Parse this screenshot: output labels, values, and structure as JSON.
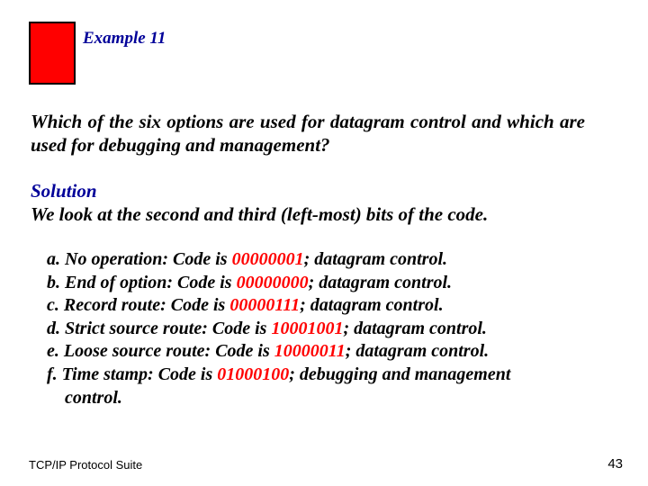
{
  "title": "Example 11",
  "question": "Which of the six options are used for datagram control and which are used for debugging and management?",
  "solution_label": "Solution",
  "solution_text": "We look at the second and third (left-most) bits of the code.",
  "options": {
    "a": {
      "letter": "a.",
      "pre": " No operation: Code is ",
      "code": "00000001",
      "post": "; datagram control."
    },
    "b": {
      "letter": "b.",
      "pre": " End of option: Code is ",
      "code": "00000000",
      "post": "; datagram control."
    },
    "c": {
      "letter": "c.",
      "pre": " Record route: Code is ",
      "code": "00000111",
      "post": "; datagram control."
    },
    "d": {
      "letter": "d.",
      "pre": " Strict source route: Code is ",
      "code": "10001001",
      "post": "; datagram control."
    },
    "e": {
      "letter": "e.",
      "pre": " Loose source route: Code is ",
      "code": "10000011",
      "post": "; datagram control."
    },
    "f": {
      "letter": "f.",
      "pre": " Time stamp: Code is ",
      "code": "01000100",
      "post": "; debugging and management",
      "post2": "control."
    }
  },
  "footer_left": "TCP/IP Protocol Suite",
  "footer_right": "43"
}
